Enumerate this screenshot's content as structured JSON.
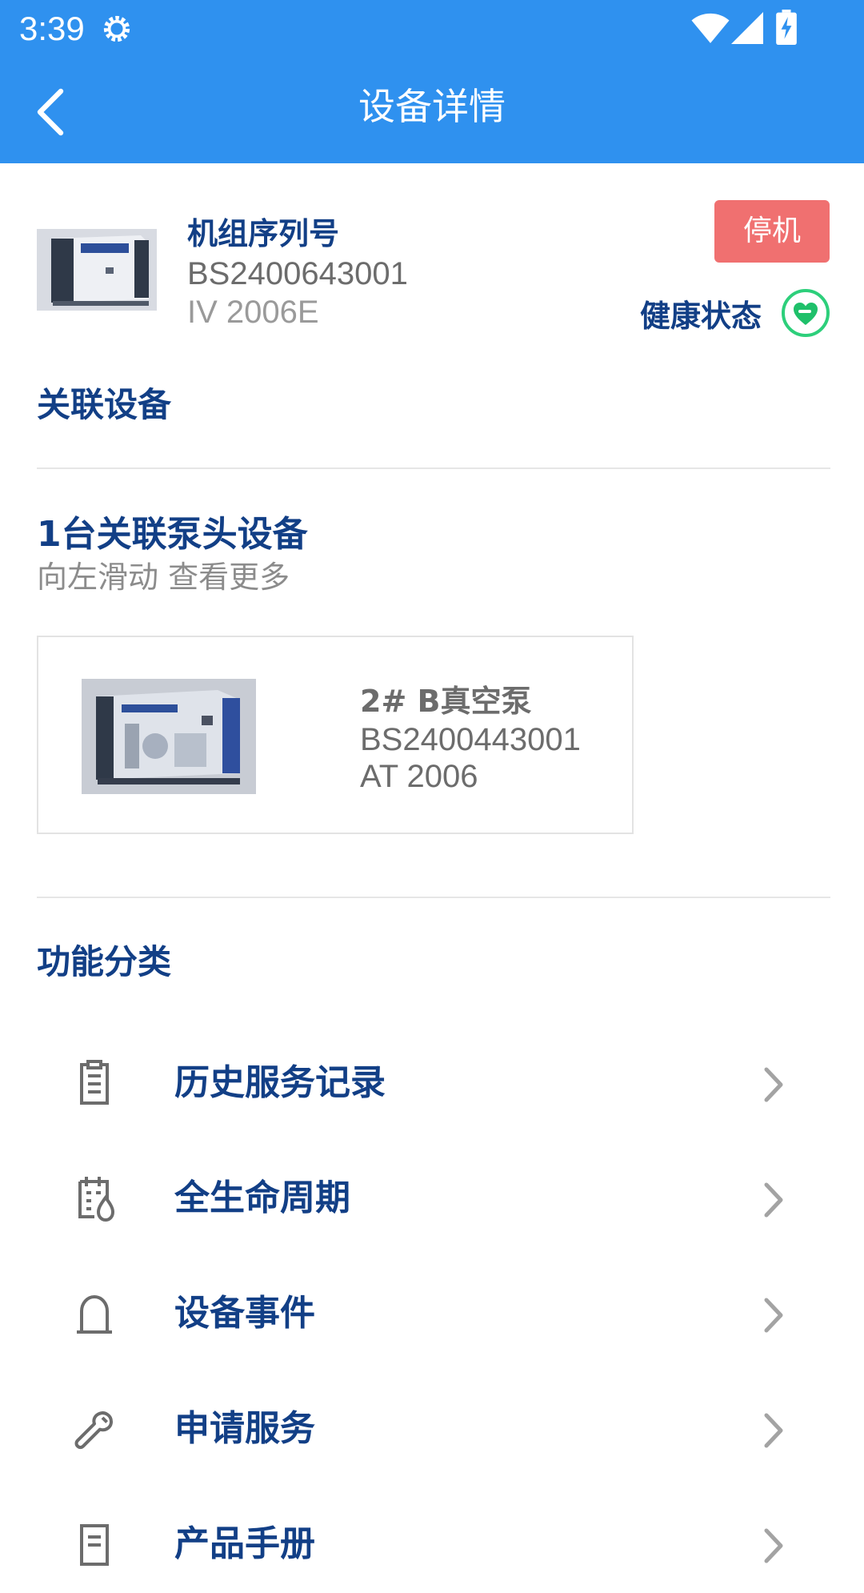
{
  "status_bar": {
    "time": "3:39",
    "icons": [
      "gear-icon",
      "wifi-icon",
      "signal-icon",
      "battery-charging-icon"
    ]
  },
  "app_bar": {
    "title": "设备详情",
    "back_icon": "chevron-left-icon"
  },
  "device": {
    "label": "机组序列号",
    "serial": "BS2400643001",
    "model": "IV 2006E",
    "status": "停机",
    "health_label": "健康状态",
    "health_icon": "heart-icon"
  },
  "related": {
    "section_title": "关联设备",
    "count_text": "1台关联泵头设备",
    "hint": "向左滑动 查看更多",
    "pumps": [
      {
        "name": "2# B真空泵",
        "serial": "BS2400443001",
        "model": "AT 2006"
      }
    ]
  },
  "functions": {
    "section_title": "功能分类",
    "items": [
      {
        "label": "历史服务记录",
        "icon": "document-icon"
      },
      {
        "label": "全生命周期",
        "icon": "calendar-drop-icon"
      },
      {
        "label": "设备事件",
        "icon": "bell-icon"
      },
      {
        "label": "申请服务",
        "icon": "wrench-icon"
      },
      {
        "label": "产品手册",
        "icon": "manual-icon"
      }
    ]
  },
  "colors": {
    "primary": "#2f91ef",
    "title_text": "#123f86",
    "status_badge": "#f07070",
    "health": "#1fc06a"
  }
}
